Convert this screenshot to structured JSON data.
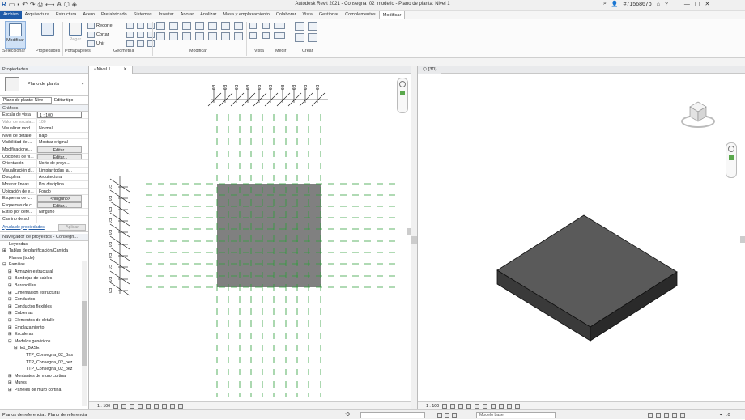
{
  "app": {
    "title": "Autodesk Revit 2021 - Consegna_02_modello - Plano de planta: Nivel 1",
    "user": "#7156867p"
  },
  "tabs": [
    "Archivo",
    "Arquitectura",
    "Estructura",
    "Acero",
    "Prefabricado",
    "Sistemas",
    "Insertar",
    "Anotar",
    "Analizar",
    "Masa y emplazamiento",
    "Colaborar",
    "Vista",
    "Gestionar",
    "Complementos",
    "Modificar"
  ],
  "ribbon": {
    "modify_label": "Modificar",
    "select_label": "Seleccionar",
    "properties_label": "Propiedades",
    "clipboard_label": "Portapapeles",
    "paste_label": "Pegar",
    "cut_label": "Recorte",
    "cortar_label": "Cortar",
    "unir_label": "Unir",
    "geometry_label": "Geometría",
    "modify_group_label": "Modificar",
    "view_group_label": "Vista",
    "measure_label": "Medir",
    "create_label": "Crear"
  },
  "properties": {
    "header": "Propiedades",
    "type_name": "Plano de planta",
    "instance": "Plano de planta: Nive",
    "edit_type": "Editar tipo",
    "section": "Gráficos",
    "rows": [
      {
        "k": "Escala de vista",
        "v": "1 : 100"
      },
      {
        "k": "Valor de escala...",
        "v": "100"
      },
      {
        "k": "Visualizar mod...",
        "v": "Normal"
      },
      {
        "k": "Nivel de detalle",
        "v": "Bajo"
      },
      {
        "k": "Visibilidad de ...",
        "v": "Mostrar original"
      },
      {
        "k": "Modificacione...",
        "v": "Editar..."
      },
      {
        "k": "Opciones de vi...",
        "v": "Editar..."
      },
      {
        "k": "Orientación",
        "v": "Norte de proye..."
      },
      {
        "k": "Visualización d...",
        "v": "Limpiar todas la..."
      },
      {
        "k": "Disciplina",
        "v": "Arquitectura"
      },
      {
        "k": "Mostrar líneas ...",
        "v": "Por disciplina"
      },
      {
        "k": "Ubicación de e...",
        "v": "Fondo"
      },
      {
        "k": "Esquema de c...",
        "v": "<ninguno>"
      },
      {
        "k": "Esquemas de c...",
        "v": "Editar..."
      },
      {
        "k": "Estilo por defe...",
        "v": "Ninguno"
      },
      {
        "k": "Camino de sol",
        "v": ""
      }
    ],
    "help_link": "Ayuda de propiedades",
    "apply": "Aplicar"
  },
  "browser": {
    "header": "Navegador de proyectos - Consegn...",
    "items": [
      {
        "t": "Leyendas",
        "lvl": 0,
        "exp": ""
      },
      {
        "t": "Tablas de planificación/Cantida",
        "lvl": 0,
        "exp": "⊞"
      },
      {
        "t": "Planos (todo)",
        "lvl": 0,
        "exp": ""
      },
      {
        "t": "Familias",
        "lvl": 0,
        "exp": "⊟"
      },
      {
        "t": "Armazón estructural",
        "lvl": 1,
        "exp": "⊞"
      },
      {
        "t": "Bandejas de cables",
        "lvl": 1,
        "exp": "⊞"
      },
      {
        "t": "Barandillas",
        "lvl": 1,
        "exp": "⊞"
      },
      {
        "t": "Cimentación estructural",
        "lvl": 1,
        "exp": "⊞"
      },
      {
        "t": "Conductos",
        "lvl": 1,
        "exp": "⊞"
      },
      {
        "t": "Conductos flexibles",
        "lvl": 1,
        "exp": "⊞"
      },
      {
        "t": "Cubiertas",
        "lvl": 1,
        "exp": "⊞"
      },
      {
        "t": "Elementos de detalle",
        "lvl": 1,
        "exp": "⊞"
      },
      {
        "t": "Emplazamiento",
        "lvl": 1,
        "exp": "⊞"
      },
      {
        "t": "Escaleras",
        "lvl": 1,
        "exp": "⊞"
      },
      {
        "t": "Modelos genéricos",
        "lvl": 1,
        "exp": "⊟"
      },
      {
        "t": "E1_BASE",
        "lvl": 2,
        "exp": "⊟"
      },
      {
        "t": "TTP_Consegna_02_Bas",
        "lvl": 3,
        "exp": ""
      },
      {
        "t": "TTP_Consegna_02_pez",
        "lvl": 3,
        "exp": ""
      },
      {
        "t": "TTP_Consegna_02_pez",
        "lvl": 3,
        "exp": ""
      },
      {
        "t": "Montantes de muro cortina",
        "lvl": 1,
        "exp": "⊞"
      },
      {
        "t": "Muros",
        "lvl": 1,
        "exp": "⊞"
      },
      {
        "t": "Paneles de muro cortina",
        "lvl": 1,
        "exp": "⊞"
      }
    ]
  },
  "view_plan": {
    "tab": "Nivel 1",
    "scale": "1 : 100",
    "grid_label": "E0"
  },
  "view_3d": {
    "tab": "{3D}",
    "scale": "1 : 100"
  },
  "status": {
    "text": "Planos de referencia : Plano de referencia",
    "model": "Modelo base",
    "filter_count": ":0"
  },
  "colors": {
    "accent": "#1e5aa8",
    "slab_plan": "#808080",
    "grid_green": "#2e9e3a"
  }
}
